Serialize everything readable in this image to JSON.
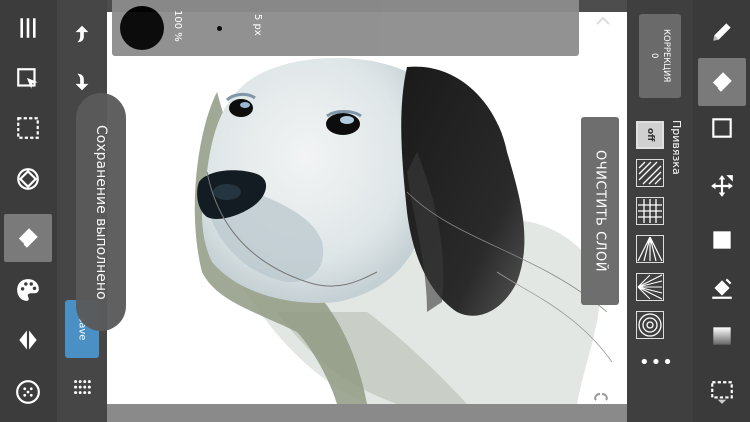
{
  "brush_bar": {
    "opacity": "100 %",
    "size": "5 px"
  },
  "toast": {
    "message": "Сохранение выполнено"
  },
  "left_tools": {
    "items": [
      "menu-icon",
      "transform-icon",
      "selection-icon",
      "rotate-icon",
      "eraser-icon",
      "palette-icon",
      "layers-icon",
      "dot-grid-icon"
    ]
  },
  "mid_tools": {
    "save_label": "save"
  },
  "canvas": {
    "clear_layer_label": "ОЧИСТИТЬ СЛОЙ"
  },
  "right_panel": {
    "correction_label": "КОРРЕКЦИЯ",
    "correction_value": "0",
    "snap_label": "Привязка",
    "snap_off": "off",
    "more": "•••"
  },
  "colors": {
    "accent_save": "#4a90c4",
    "panel_dark": "#3c3c3c",
    "active_tool": "#7a7a7a"
  }
}
